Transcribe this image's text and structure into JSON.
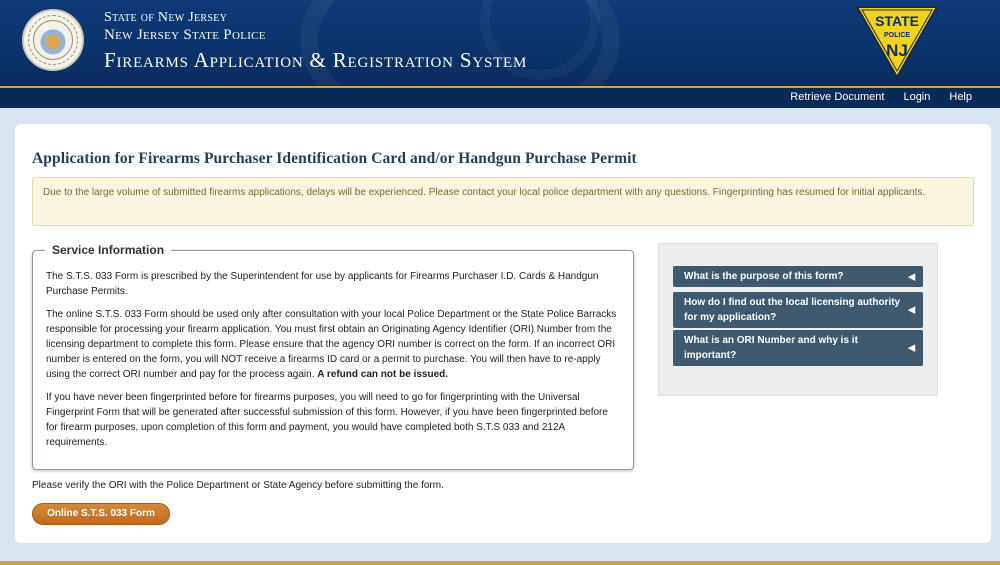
{
  "header": {
    "line1": "State of New Jersey",
    "line2": "New Jersey State Police",
    "line3": "Firearms Application & Registration System",
    "badge_top": "STATE",
    "badge_mid": "POLICE",
    "badge_nj": "NJ"
  },
  "nav": {
    "retrieve": "Retrieve Document",
    "login": "Login",
    "help": "Help"
  },
  "main": {
    "title": "Application for Firearms Purchaser Identification Card and/or Handgun Purchase Permit",
    "notice": "Due to the large volume of submitted firearms applications, delays will be experienced. Please contact your local police department with any questions. Fingerprinting has resumed for initial applicants.",
    "service": {
      "legend": "Service Information",
      "p1": "The S.T.S. 033 Form is prescribed by the Superintendent for use by applicants for Firearms Purchaser I.D. Cards & Handgun Purchase Permits.",
      "p2": "The online S.T.S. 033 Form should be used only after consultation with your local Police Department or the State Police Barracks responsible for processing your firearm application. You must first obtain an Originating Agency Identifier (ORI) Number from the licensing department to complete this form. Please ensure that the agency ORI number is correct on the form. If an incorrect ORI number is entered on the form, you will NOT receive a firearms ID card or a permit to purchase. You will then have to re-apply using the correct ORI number and pay for the process again.",
      "p2_bold": "A refund can not be issued.",
      "p3": "If you have never been fingerprinted before for firearms purposes, you will need to go for fingerprinting with the Universal Fingerprint Form that will be generated after successful submission of this form. However, if you have been fingerprinted before for firearm purposes, upon completion of this form and payment, you would have completed both S.T.S 033 and 212A requirements."
    },
    "verify_text": "Please verify the ORI with the Police Department or State Agency before submitting the form.",
    "form_button": "Online S.T.S. 033 Form"
  },
  "faq": [
    {
      "label": "What is the purpose of this form?"
    },
    {
      "label": "How do I find out the local licensing authority for my application?"
    },
    {
      "label": "What is an ORI Number and why is it important?"
    }
  ],
  "colors": {
    "header_blue": "#0d3a78",
    "gold": "#d4a62c",
    "badge_yellow": "#f2d21e",
    "button_orange": "#c8762a",
    "faq_blue": "#3f5a6e"
  },
  "icons": {
    "seal": "nj-state-seal",
    "badge": "nj-state-police-badge",
    "faq_expand": "left-triangle-icon"
  }
}
